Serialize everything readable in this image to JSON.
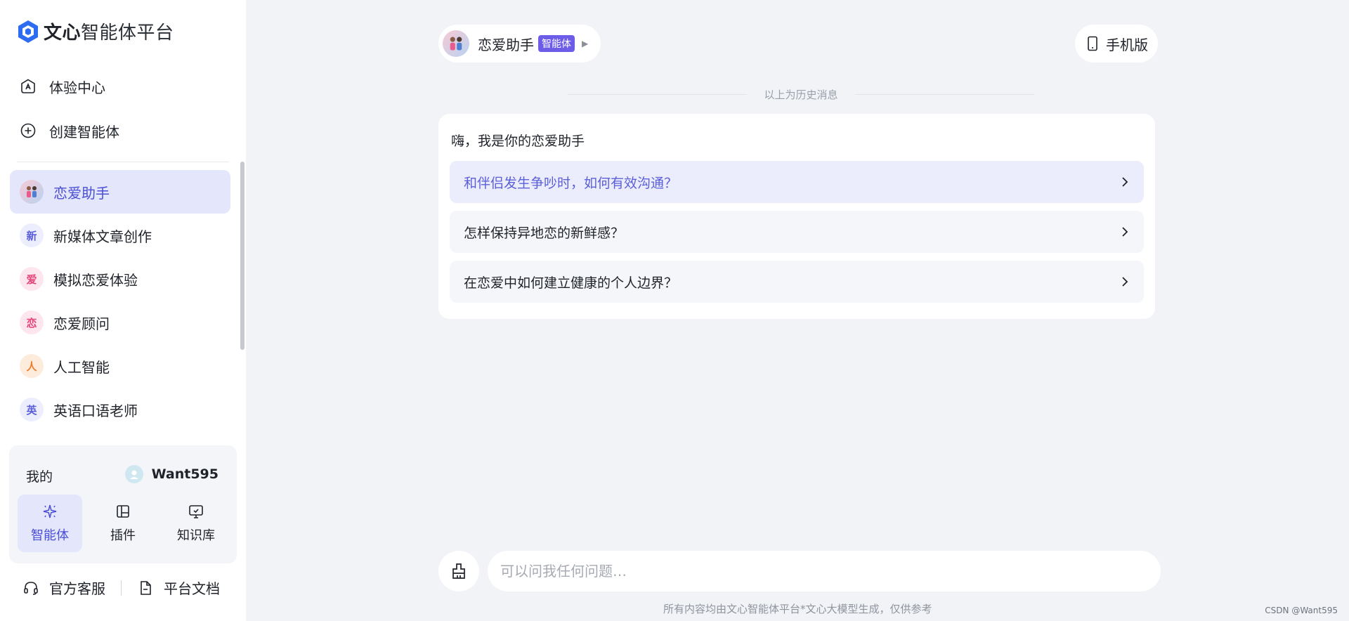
{
  "brand": {
    "strong": "文心",
    "rest": "智能体平台"
  },
  "nav": [
    {
      "id": "experience",
      "label": "体验中心"
    },
    {
      "id": "create",
      "label": "创建智能体"
    }
  ],
  "agents": [
    {
      "label": "恋爱助手",
      "badge": "",
      "active": true
    },
    {
      "label": "新媒体文章创作",
      "badge": "新"
    },
    {
      "label": "模拟恋爱体验",
      "badge": "爱"
    },
    {
      "label": "恋爱顾问",
      "badge": "恋"
    },
    {
      "label": "人工智能",
      "badge": "人"
    },
    {
      "label": "英语口语老师",
      "badge": "英"
    }
  ],
  "mine": {
    "label": "我的",
    "username": "Want595",
    "tools": [
      {
        "label": "智能体",
        "active": true
      },
      {
        "label": "插件"
      },
      {
        "label": "知识库"
      }
    ]
  },
  "footer_links": {
    "service": "官方客服",
    "docs": "平台文档"
  },
  "chat": {
    "agent_name": "恋爱助手",
    "agent_tag": "智能体",
    "mobile_label": "手机版",
    "history_label": "以上为历史消息",
    "greeting": "嗨，我是你的恋爱助手",
    "suggestions": [
      "和伴侣发生争吵时，如何有效沟通？",
      "怎样保持异地恋的新鲜感？",
      "在恋爱中如何建立健康的个人边界？"
    ],
    "input_placeholder": "可以问我任何问题…",
    "disclaimer": "所有内容均由文心智能体平台*文心大模型生成，仅供参考"
  },
  "credit": "CSDN @Want595",
  "colors": {
    "accent": "#4a4fd6",
    "active_bg": "#e4e6fc",
    "tag": "#6c5ce7"
  }
}
